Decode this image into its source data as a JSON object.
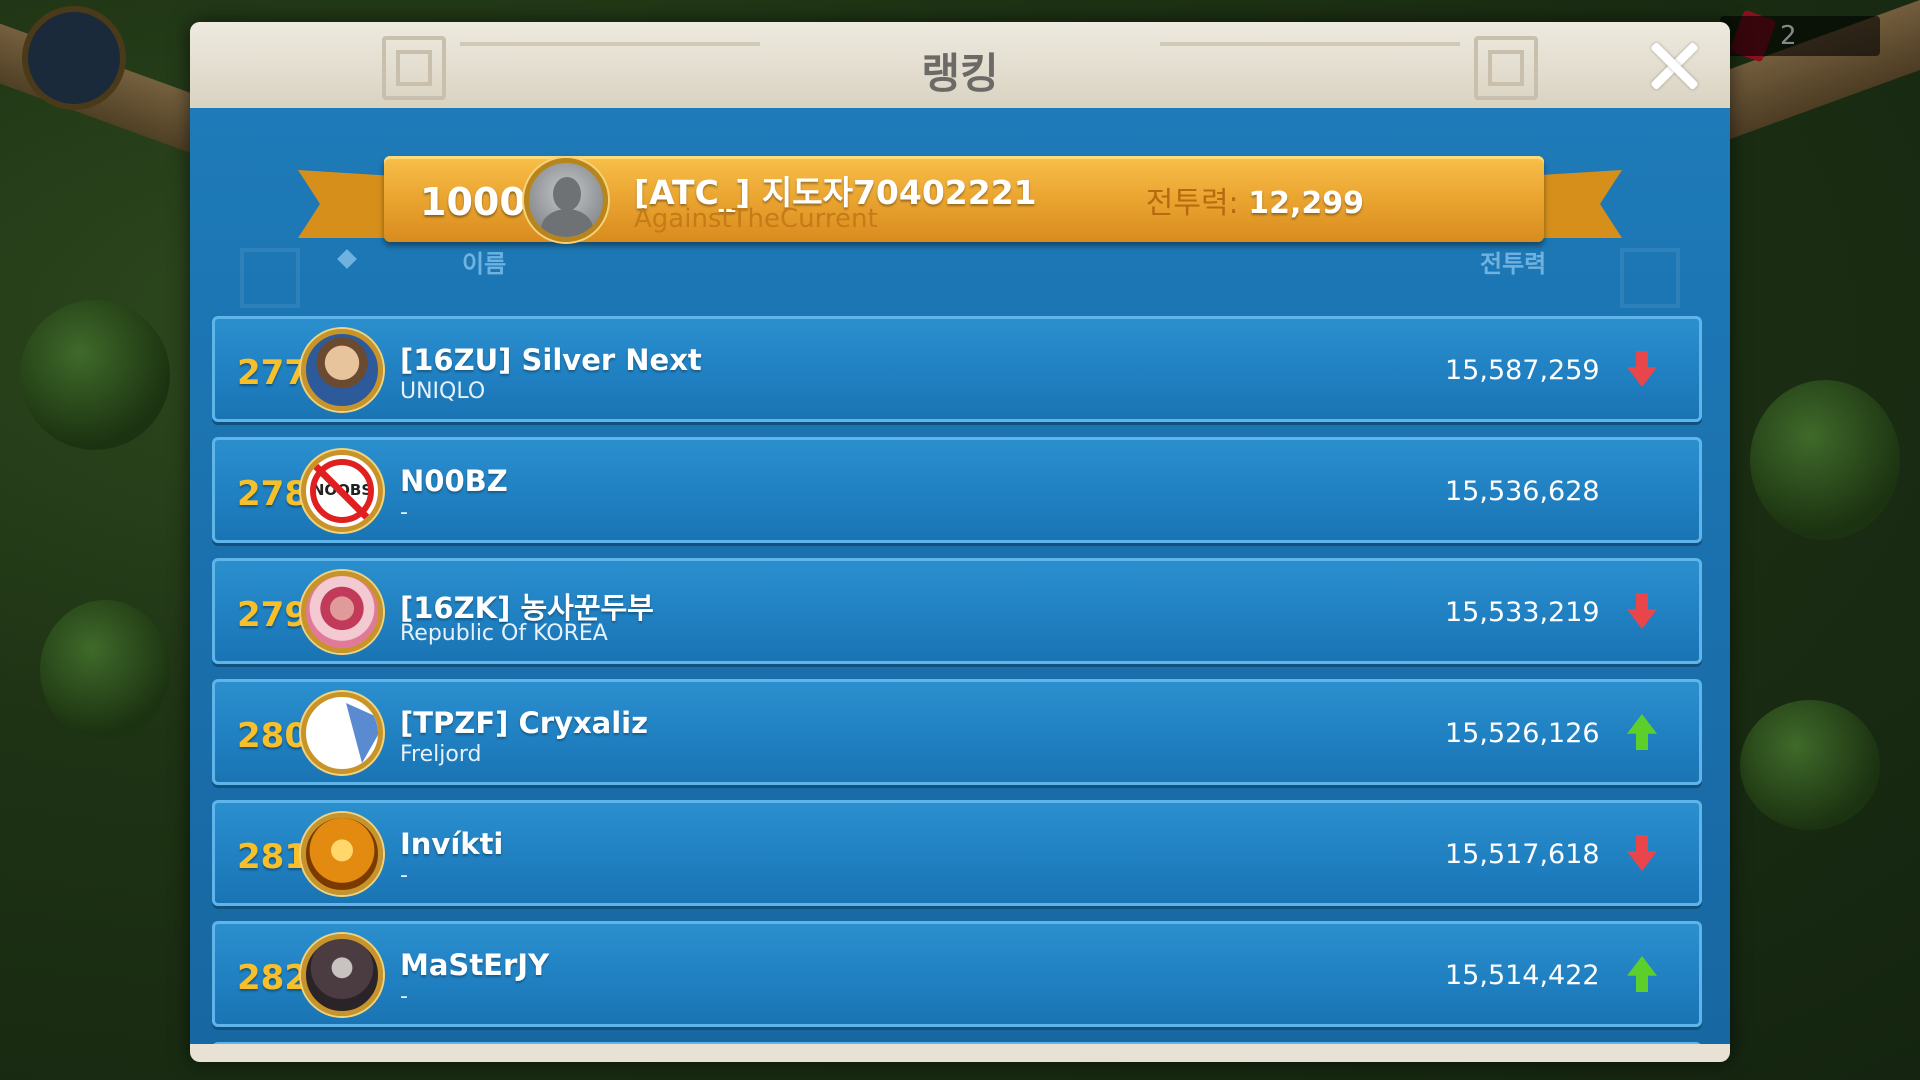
{
  "background": {
    "counter_value": "2"
  },
  "dialog": {
    "title": "랭킹",
    "close_icon": "close-icon"
  },
  "my_entry": {
    "rank": "1000+",
    "name": "[ATC_] 지도자70402221",
    "guild": "AgainstTheCurrent",
    "power_label": "전투력:",
    "power_value": "12,299"
  },
  "columns": {
    "name": "이름",
    "power": "전투력"
  },
  "rows": [
    {
      "rank": "277",
      "name": "[16ZU] Silver Next",
      "sub": "UNIQLO",
      "power": "15,587,259",
      "trend": "down"
    },
    {
      "rank": "278",
      "name": "N00BZ",
      "sub": "-",
      "power": "15,536,628",
      "trend": "none"
    },
    {
      "rank": "279",
      "name": "[16ZK] 농사꾼두부",
      "sub": "Republic Of KOREA",
      "power": "15,533,219",
      "trend": "down"
    },
    {
      "rank": "280",
      "name": "[TPZF] Cryxaliz",
      "sub": "Freljord",
      "power": "15,526,126",
      "trend": "up"
    },
    {
      "rank": "281",
      "name": "Invíkti",
      "sub": "-",
      "power": "15,517,618",
      "trend": "down"
    },
    {
      "rank": "282",
      "name": "MaStErJY",
      "sub": "-",
      "power": "15,514,422",
      "trend": "up"
    }
  ],
  "avatar_labels": {
    "noobs": "NOOBS"
  },
  "colors": {
    "rank_gold": "#f7c02a",
    "row_blue": "#1f7fc0",
    "trend_up": "#5ccf2a",
    "trend_down": "#e8464a"
  }
}
